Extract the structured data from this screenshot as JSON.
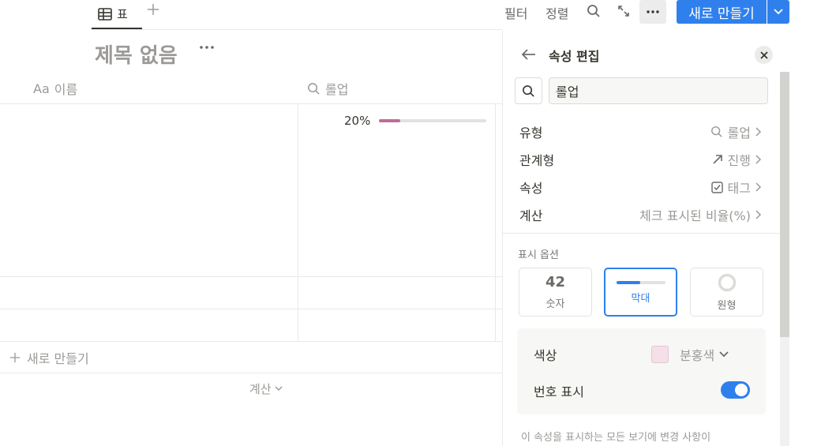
{
  "toolbar": {
    "view_tab_label": "표",
    "filter_label": "필터",
    "sort_label": "정렬",
    "new_label": "새로 만들기"
  },
  "page": {
    "title": "제목 없음"
  },
  "table": {
    "columns": [
      {
        "icon": "Aa",
        "label": "이름"
      },
      {
        "label": "롤업"
      }
    ],
    "rows": [
      {
        "rollup_percent_label": "20%",
        "rollup_value": 0.2
      }
    ],
    "new_row_label": "새로 만들기",
    "calc_label": "계산"
  },
  "panel": {
    "title": "속성 편집",
    "name_value": "롤업",
    "props": [
      {
        "label": "유형",
        "value": "롤업",
        "icon": "search-icon"
      },
      {
        "label": "관계형",
        "value": "진행",
        "icon": "arrow-up-right-icon"
      },
      {
        "label": "속성",
        "value": "태그",
        "icon": "checkbox-icon"
      },
      {
        "label": "계산",
        "value": "체크 표시된 비율(%)"
      }
    ],
    "display_section_label": "표시 옵션",
    "display_options": [
      {
        "number": "42",
        "label": "숫자"
      },
      {
        "label": "막대"
      },
      {
        "label": "원형"
      }
    ],
    "color_label": "색상",
    "color_value": "분홍색",
    "color_hex": "#f5e0e9",
    "show_number_label": "번호 표시",
    "show_number_on": true,
    "footnote": "이 속성을 표시하는 모든 보기에 변경 사항이"
  },
  "colors": {
    "accent": "#2f80ed",
    "bar_fill": "#c06c98"
  }
}
